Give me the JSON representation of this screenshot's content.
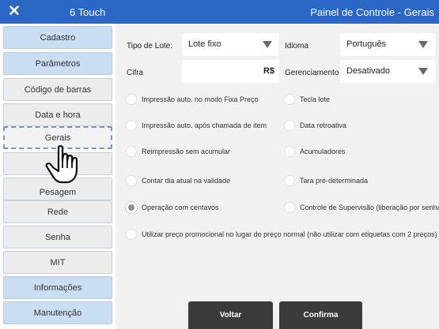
{
  "titlebar": {
    "app_name": "6 Touch",
    "title": "Painel de Controle - Gerais"
  },
  "sidebar": {
    "items": [
      {
        "label": "Cadastro"
      },
      {
        "label": "Parâmetros"
      },
      {
        "label": "Código de barras"
      },
      {
        "label": "Data e hora"
      },
      {
        "label": "Gerais"
      },
      {
        "label": "Pesagem"
      },
      {
        "label": "Rede"
      },
      {
        "label": "Senha"
      },
      {
        "label": "MIT"
      },
      {
        "label": "Informações"
      },
      {
        "label": "Manutenção"
      }
    ]
  },
  "form": {
    "tipo_lote_label": "Tipo de Lote:",
    "tipo_lote_value": "Lote fixo",
    "idioma_label": "Idioma",
    "idioma_value": "Português",
    "cifra_label": "Cifra",
    "cifra_suffix": "R$",
    "gerenciamento_label": "Gerenciamento",
    "gerenciamento_value": "Desativado"
  },
  "options": {
    "left": [
      {
        "label": "Impressão auto. no modo Fixa Preço",
        "checked": false
      },
      {
        "label": "Impressão auto. após chamada de item",
        "checked": false
      },
      {
        "label": "Reimpressão sem acumular",
        "checked": false
      },
      {
        "label": "Contar dia atual na validade",
        "checked": false
      },
      {
        "label": "Operação com centavos",
        "checked": true
      }
    ],
    "right": [
      {
        "label": "Tecla lote",
        "checked": false
      },
      {
        "label": "Data retroativa",
        "checked": false
      },
      {
        "label": "Acumuladores",
        "checked": false
      },
      {
        "label": "Tara pré-determinada",
        "checked": false
      },
      {
        "label": "Controle de Supervisão (liberação por senha)",
        "checked": false
      }
    ],
    "wide": {
      "label": "Utilizar preço promocional no lugar do preço normal (não utilizar com etiquetas com 2 preços)",
      "checked": false
    }
  },
  "buttons": {
    "back": "Voltar",
    "confirm": "Confirma"
  },
  "colors": {
    "titlebar": "#2b68c6",
    "sidebar_blue": "#c9def3",
    "button_dark": "#3b3b3b"
  }
}
